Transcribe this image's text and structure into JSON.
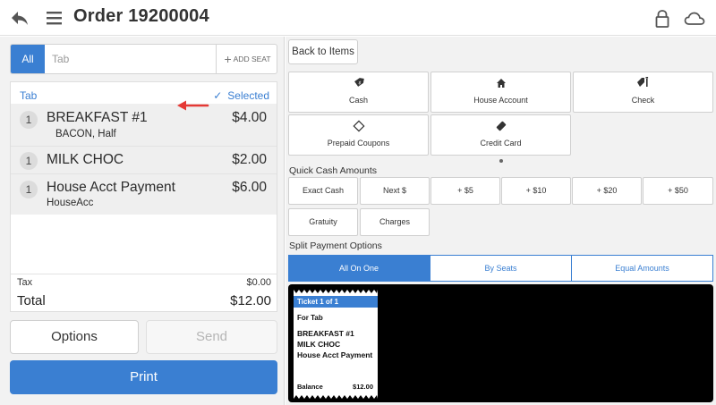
{
  "header": {
    "title": "Order 19200004",
    "icons": [
      "back-arrow-icon",
      "hamburger-menu-icon",
      "lock-icon",
      "cloud-icon"
    ]
  },
  "order_panel": {
    "tab_all_label": "All",
    "tab_placeholder": "Tab",
    "add_seat_label": "ADD SEAT",
    "ticket_header": {
      "tab_label": "Tab",
      "selected_label": "Selected"
    },
    "items": [
      {
        "qty": "1",
        "name": "BREAKFAST #1",
        "price": "$4.00",
        "modifier": "BACON, Half"
      },
      {
        "qty": "1",
        "name": "MILK CHOC",
        "price": "$2.00",
        "modifier": ""
      },
      {
        "qty": "1",
        "name": "House Acct Payment",
        "price": "$6.00",
        "modifier": "HouseAcc"
      }
    ],
    "tax_label": "Tax",
    "tax_value": "$0.00",
    "total_label": "Total",
    "total_value": "$12.00",
    "options_label": "Options",
    "send_label": "Send",
    "print_label": "Print",
    "annotation_color": "#e53935"
  },
  "payment_panel": {
    "back_to_items_label": "Back to Items",
    "payment_methods": [
      {
        "label": "Cash",
        "icon": "cash-tag-icon"
      },
      {
        "label": "House Account",
        "icon": "house-icon"
      },
      {
        "label": "Check",
        "icon": "check-tag-icon"
      },
      {
        "label": "Prepaid Coupons",
        "icon": "coupon-icon"
      },
      {
        "label": "Credit Card",
        "icon": "credit-card-icon"
      }
    ],
    "quick_cash_title": "Quick Cash Amounts",
    "quick_cash": [
      "Exact Cash",
      "Next $",
      "+ $5",
      "+ $10",
      "+ $20",
      "+ $50"
    ],
    "extra_buttons": [
      "Gratuity",
      "Charges"
    ],
    "split_title": "Split Payment Options",
    "split_options": [
      "All On One",
      "By Seats",
      "Equal Amounts"
    ],
    "split_active": "All On One",
    "mini_ticket": {
      "header": "Ticket 1 of 1",
      "for_label": "For Tab",
      "lines": [
        "BREAKFAST #1",
        "MILK CHOC",
        "House Acct Payment"
      ],
      "balance_label": "Balance",
      "balance_value": "$12.00"
    }
  },
  "colors": {
    "accent": "#3a7fd2",
    "annotation_arrow": "#e53935"
  }
}
